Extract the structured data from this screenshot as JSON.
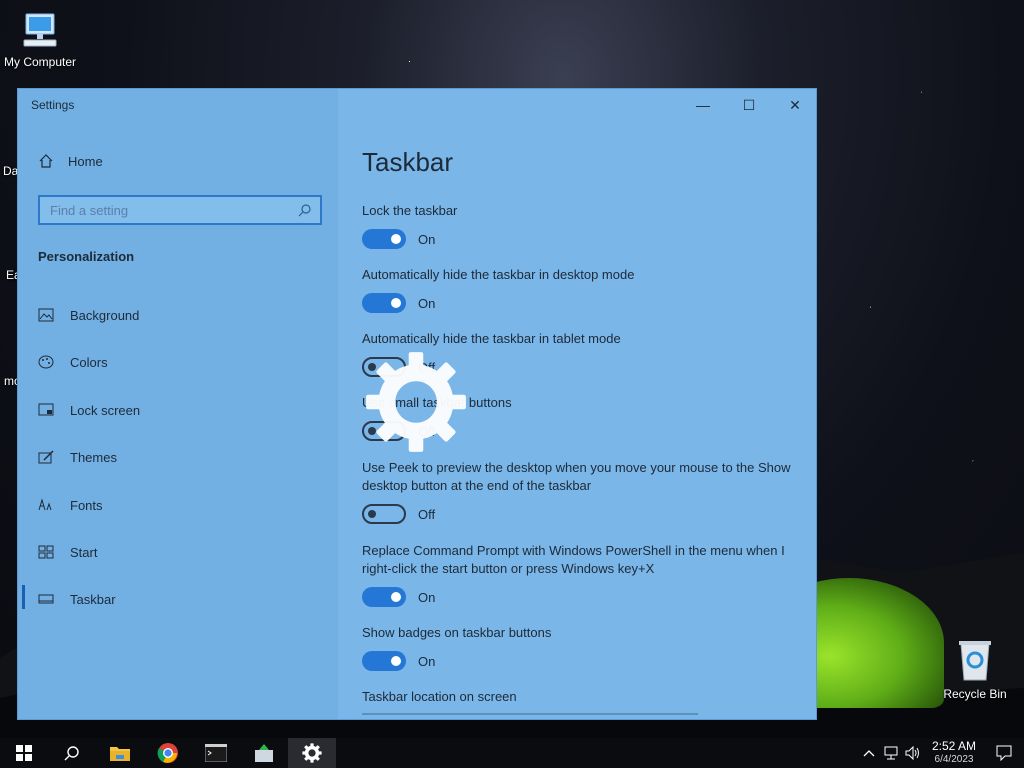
{
  "desktop": {
    "icons": [
      {
        "label": "My Computer"
      },
      {
        "label": "Recycle Bin"
      }
    ],
    "partial_labels": [
      "Da",
      "Ea",
      "mo"
    ]
  },
  "window": {
    "title": "Settings",
    "controls": {
      "minimize": "—",
      "maximize": "☐",
      "close": "✕"
    }
  },
  "sidebar": {
    "home_label": "Home",
    "search_placeholder": "Find a setting",
    "section_title": "Personalization",
    "items": [
      {
        "label": "Background",
        "icon": "image-icon"
      },
      {
        "label": "Colors",
        "icon": "palette-icon"
      },
      {
        "label": "Lock screen",
        "icon": "lock-screen-icon"
      },
      {
        "label": "Themes",
        "icon": "brush-icon"
      },
      {
        "label": "Fonts",
        "icon": "font-icon"
      },
      {
        "label": "Start",
        "icon": "start-tiles-icon"
      },
      {
        "label": "Taskbar",
        "icon": "taskbar-icon",
        "active": true
      }
    ]
  },
  "main": {
    "title": "Taskbar",
    "settings": [
      {
        "label": "Lock the taskbar",
        "state": "On"
      },
      {
        "label": "Automatically hide the taskbar in desktop mode",
        "state": "On"
      },
      {
        "label": "Automatically hide the taskbar in tablet mode",
        "state": "Off"
      },
      {
        "label": "Use small taskbar buttons",
        "state": "Off"
      },
      {
        "label": "Use Peek to preview the desktop when you move your mouse to the Show desktop button at the end of the taskbar",
        "state": "Off"
      },
      {
        "label": "Replace Command Prompt with Windows PowerShell in the menu when I right-click the start button or press Windows key+X",
        "state": "On"
      },
      {
        "label": "Show badges on taskbar buttons",
        "state": "On"
      }
    ],
    "location_label": "Taskbar location on screen"
  },
  "taskbar": {
    "time": "2:52 AM",
    "date": "6/4/2023"
  },
  "colors": {
    "accent": "#2477d4",
    "window_bg": "#7ab6e8"
  }
}
